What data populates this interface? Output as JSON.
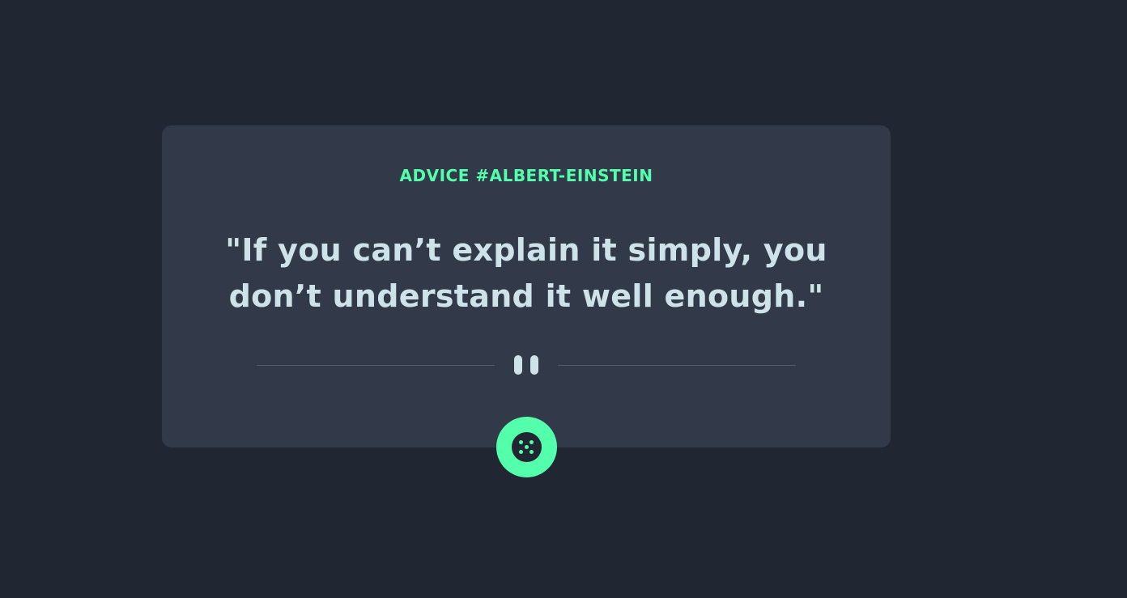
{
  "advice": {
    "heading": "ADVICE #ALBERT-EINSTEIN",
    "quote": "\"If you can’t explain it simply, you don’t understand it well enough.\""
  },
  "icons": {
    "divider": "pause-icon",
    "button": "dice-icon"
  },
  "colors": {
    "background": "#202632",
    "card": "#323a49",
    "accent": "#53ffaa",
    "text": "#cee3e9",
    "divider_line": "#4f5d74"
  }
}
